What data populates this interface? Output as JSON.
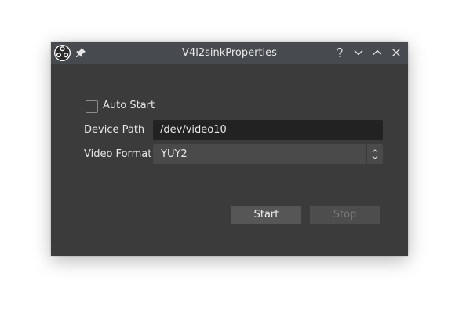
{
  "window": {
    "title": "V4l2sinkProperties",
    "buttons": {
      "help": "?",
      "minimize": "minimize",
      "maximize": "maximize",
      "close": "close"
    }
  },
  "form": {
    "auto_start_label": "Auto Start",
    "auto_start_checked": false,
    "device_path_label": "Device Path",
    "device_path_value": "/dev/video10",
    "video_format_label": "Video Format",
    "video_format_value": "YUY2",
    "start_label": "Start",
    "stop_label": "Stop"
  },
  "colors": {
    "window_bg": "#3b3b3b",
    "titlebar_bg": "#474a4f",
    "input_bg": "#222222",
    "select_bg": "#4a4a4a",
    "button_bg": "#565656",
    "disabled_text": "#7c7c7c"
  },
  "icons": {
    "app": "obs-logo-icon",
    "pin": "pin-icon"
  }
}
